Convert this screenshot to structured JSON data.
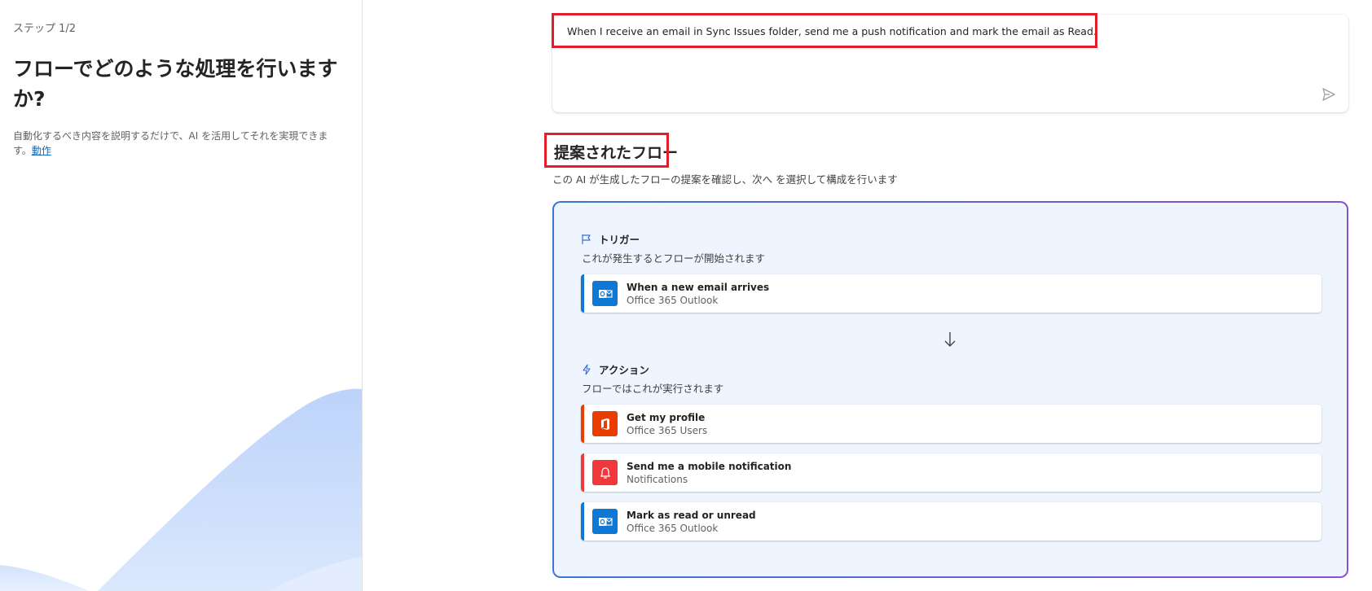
{
  "left_panel": {
    "step_label": "ステップ 1/2",
    "title": "フローでどのような処理を行いますか?",
    "description": "自動化するべき内容を説明するだけで、AI を活用してそれを実現できます。",
    "link_label": "動作"
  },
  "prompt": {
    "text": "When I receive an email in Sync Issues folder, send me a push notification and mark the email as Read."
  },
  "suggested": {
    "heading": "提案されたフロー",
    "subheading": "この AI が生成したフローの提案を確認し、次へ を選択して構成を行います",
    "trigger": {
      "label": "トリガー",
      "description": "これが発生するとフローが開始されます",
      "step": {
        "title": "When a new email arrives",
        "connector": "Office 365 Outlook",
        "icon": "outlook-icon",
        "color": "#0f78d4"
      }
    },
    "actions": {
      "label": "アクション",
      "description": "フローではこれが実行されます",
      "steps": [
        {
          "title": "Get my profile",
          "connector": "Office 365 Users",
          "icon": "office-icon",
          "color": "#eb3c00"
        },
        {
          "title": "Send me a mobile notification",
          "connector": "Notifications",
          "icon": "bell-icon",
          "color": "#f0383a"
        },
        {
          "title": "Mark as read or unread",
          "connector": "Office 365 Outlook",
          "icon": "outlook-icon",
          "color": "#0f78d4"
        }
      ]
    }
  },
  "colors": {
    "highlight": "#e01f2b",
    "link": "#0f6cbd",
    "card_background": "#eef5fe"
  }
}
